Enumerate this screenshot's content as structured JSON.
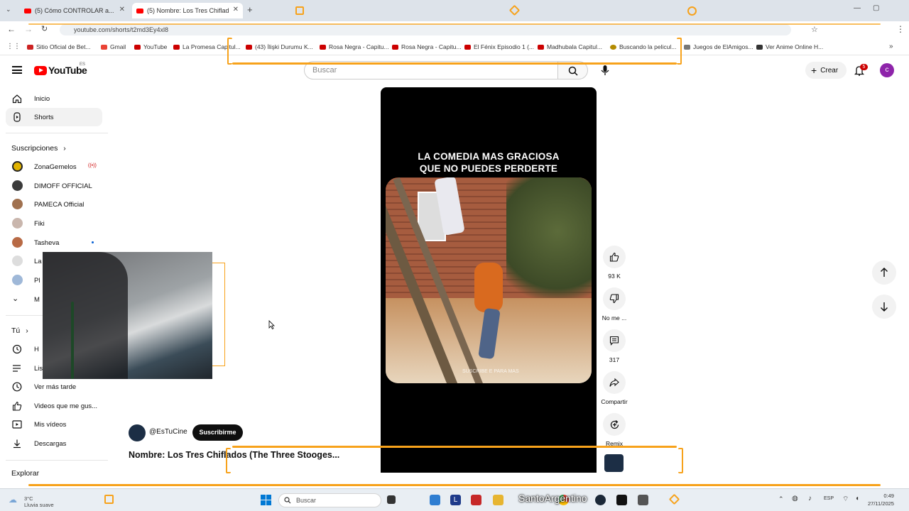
{
  "browser": {
    "tabs": [
      {
        "title": "(5) Cómo CONTROLAR a..."
      },
      {
        "title": "(5) Nombre: Los Tres Chiflad"
      }
    ],
    "url": "youtube.com/shorts/t2md3Ey4xl8",
    "bookmarks": [
      {
        "label": "Sitio Oficial de Bet..."
      },
      {
        "label": "Gmail"
      },
      {
        "label": "YouTube"
      },
      {
        "label": "La Promesa Capitul..."
      },
      {
        "label": "(43) İlişki Durumu K..."
      },
      {
        "label": "Rosa Negra - Capitu..."
      },
      {
        "label": "Rosa Negra - Capitu..."
      },
      {
        "label": "El Fénix Episodio 1 (..."
      },
      {
        "label": "Madhubala Capitul..."
      },
      {
        "label": "Buscando la pelicul..."
      },
      {
        "label": "Juegos de ElAmigos..."
      },
      {
        "label": "Ver Anime Online H..."
      }
    ]
  },
  "header": {
    "logo": "YouTube",
    "country": "ES",
    "search_placeholder": "Buscar",
    "create_label": "Crear",
    "notifications": "5",
    "avatar_letter": "c"
  },
  "sidebar": {
    "main": [
      {
        "label": "Inicio"
      },
      {
        "label": "Shorts"
      }
    ],
    "subscriptions_heading": "Suscripciones",
    "subscriptions": [
      {
        "label": "ZonaGemelos"
      },
      {
        "label": "DIMOFF OFFICIAL"
      },
      {
        "label": "PAMECA Official"
      },
      {
        "label": "Fiki"
      },
      {
        "label": "Tasheva"
      },
      {
        "label": "La"
      },
      {
        "label": "Pl"
      },
      {
        "label": "M"
      }
    ],
    "you_heading": "Tú",
    "you_items": [
      {
        "label": "H"
      },
      {
        "label": "Lis"
      },
      {
        "label": "Ver más tarde"
      },
      {
        "label": "Videos que me gus..."
      },
      {
        "label": "Mis vídeos"
      },
      {
        "label": "Descargas"
      }
    ],
    "explore_heading": "Explorar"
  },
  "short": {
    "caption_line1": "LA COMEDIA MAS GRACIOSA",
    "caption_line2": "QUE NO PUEDES PERDERTE",
    "watermark": "SUSCRIBE E PARA MAS",
    "channel": "@EsTuCine",
    "subscribe_label": "Suscribirme",
    "title": "Nombre: Los Tres Chiflados (The Three Stooges..."
  },
  "actions": {
    "likes": "93 K",
    "dislike": "No me ...",
    "comments": "317",
    "share": "Compartir",
    "remix": "Remix"
  },
  "taskbar": {
    "weather_line1": "3°C",
    "weather_line2": "Lluvia suave",
    "search": "Buscar",
    "overlay_name": "SantoArgentino",
    "lang": "ESP",
    "time": "0:49",
    "date": "27/11/2025"
  },
  "colors": {
    "youtube_red": "#ff0000",
    "overlay_orange": "#f7a21b",
    "avatar_purple": "#8e24aa"
  }
}
